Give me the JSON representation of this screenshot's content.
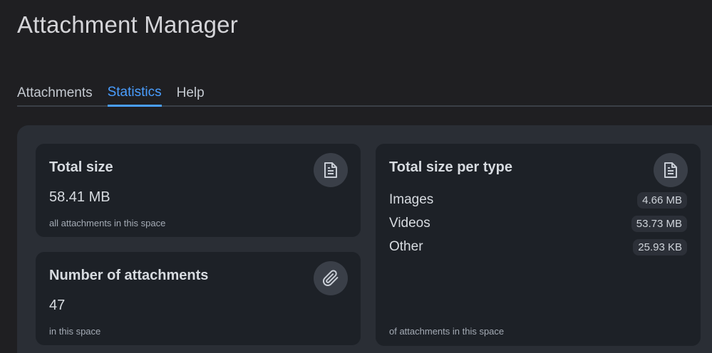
{
  "app": {
    "title": "Attachment Manager"
  },
  "tabs": [
    {
      "label": "Attachments",
      "active": false
    },
    {
      "label": "Statistics",
      "active": true
    },
    {
      "label": "Help",
      "active": false
    }
  ],
  "colors": {
    "accent": "#4a9eff",
    "background": "#1f1f22",
    "panel": "#2a2e35",
    "card": "#1d2127"
  },
  "cards": {
    "total_size": {
      "title": "Total size",
      "value": "58.41 MB",
      "subtitle": "all attachments in this space",
      "icon": "file-text-icon"
    },
    "num_attachments": {
      "title": "Number of attachments",
      "value": "47",
      "subtitle": "in this space",
      "icon": "paperclip-icon"
    },
    "size_per_type": {
      "title": "Total size per type",
      "icon": "file-text-icon",
      "subtitle": "of attachments in this space",
      "rows": [
        {
          "label": "Images",
          "value": "4.66 MB"
        },
        {
          "label": "Videos",
          "value": "53.73 MB"
        },
        {
          "label": "Other",
          "value": "25.93 KB"
        }
      ]
    }
  }
}
